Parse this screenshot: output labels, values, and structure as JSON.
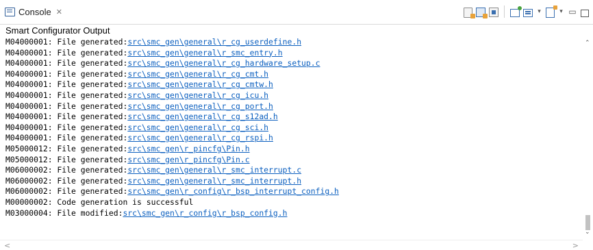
{
  "tab": {
    "title": "Console",
    "close_symbol": "✕",
    "icon": "console-icon"
  },
  "toolbar": {
    "buttons": [
      {
        "name": "clear-console-button",
        "icon": "clear-console-icon"
      },
      {
        "name": "scroll-lock-button",
        "icon": "scroll-lock-icon"
      },
      {
        "name": "pin-console-button",
        "icon": "pin-console-icon"
      },
      {
        "name": "display-selected-console-button",
        "icon": "display-console-icon"
      },
      {
        "name": "open-console-button",
        "icon": "open-console-icon"
      },
      {
        "name": "new-console-button",
        "icon": "new-console-icon"
      },
      {
        "name": "minimize-button",
        "icon": "minimize-icon"
      },
      {
        "name": "maximize-button",
        "icon": "maximize-icon"
      }
    ]
  },
  "console": {
    "header": "Smart Configurator Output",
    "lines": [
      {
        "prefix": "M04000001: File generated:",
        "link": "src\\smc_gen\\general\\r_cg_userdefine.h"
      },
      {
        "prefix": "M04000001: File generated:",
        "link": "src\\smc_gen\\general\\r_smc_entry.h"
      },
      {
        "prefix": "M04000001: File generated:",
        "link": "src\\smc_gen\\general\\r_cg_hardware_setup.c"
      },
      {
        "prefix": "M04000001: File generated:",
        "link": "src\\smc_gen\\general\\r_cg_cmt.h"
      },
      {
        "prefix": "M04000001: File generated:",
        "link": "src\\smc_gen\\general\\r_cg_cmtw.h"
      },
      {
        "prefix": "M04000001: File generated:",
        "link": "src\\smc_gen\\general\\r_cg_icu.h"
      },
      {
        "prefix": "M04000001: File generated:",
        "link": "src\\smc_gen\\general\\r_cg_port.h"
      },
      {
        "prefix": "M04000001: File generated:",
        "link": "src\\smc_gen\\general\\r_cg_s12ad.h"
      },
      {
        "prefix": "M04000001: File generated:",
        "link": "src\\smc_gen\\general\\r_cg_sci.h"
      },
      {
        "prefix": "M04000001: File generated:",
        "link": "src\\smc_gen\\general\\r_cg_rspi.h"
      },
      {
        "prefix": "M05000012: File generated:",
        "link": "src\\smc_gen\\r_pincfg\\Pin.h"
      },
      {
        "prefix": "M05000012: File generated:",
        "link": "src\\smc_gen\\r_pincfg\\Pin.c"
      },
      {
        "prefix": "M06000002: File generated:",
        "link": "src\\smc_gen\\general\\r_smc_interrupt.c"
      },
      {
        "prefix": "M06000002: File generated:",
        "link": "src\\smc_gen\\general\\r_smc_interrupt.h"
      },
      {
        "prefix": "M06000002: File generated:",
        "link": "src\\smc_gen\\r_config\\r_bsp_interrupt_config.h"
      },
      {
        "prefix": "M00000002: Code generation is successful",
        "link": ""
      },
      {
        "prefix": "M03000004: File modified:",
        "link": "src\\smc_gen\\r_config\\r_bsp_config.h"
      }
    ]
  },
  "colors": {
    "link": "#0b5fbf",
    "text": "#000000",
    "icon_blue": "#3a6fb0",
    "icon_orange": "#e8a23a"
  }
}
